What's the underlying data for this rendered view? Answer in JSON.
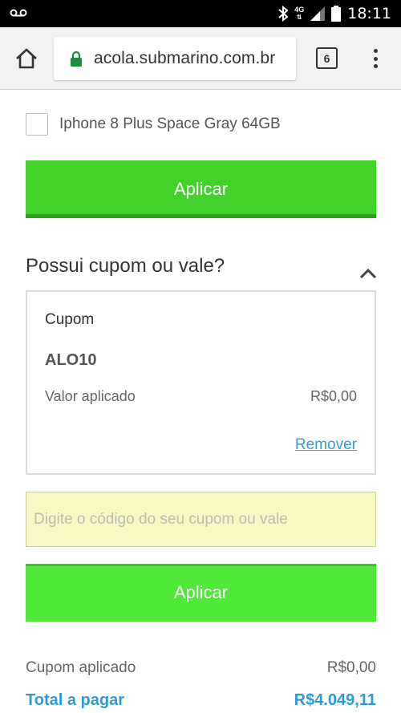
{
  "status_bar": {
    "network": "4G",
    "time": "18:11"
  },
  "browser": {
    "url": "acola.submarino.com.br",
    "tab_count": "6"
  },
  "product": {
    "label": "Iphone 8 Plus Space Gray 64GB",
    "checked": false
  },
  "buttons": {
    "apply_label": "Aplicar"
  },
  "coupon": {
    "section_title": "Possui cupom ou vale?",
    "card_label": "Cupom",
    "code": "ALO10",
    "value_label": "Valor aplicado",
    "value": "R$0,00",
    "remove_label": "Remover",
    "input_placeholder": "Digite o código do seu cupom ou vale",
    "input_value": ""
  },
  "summary": {
    "applied_label": "Cupom aplicado",
    "applied_value": "R$0,00",
    "total_label": "Total a pagar",
    "total_value": "R$4.049,11"
  },
  "colors": {
    "apply_button": "#43d12b",
    "total_text": "#2e9ad6",
    "remove_link": "#3a9bd5",
    "input_background": "#f7f8c3"
  },
  "icons": [
    "voicemail-icon",
    "bluetooth-icon",
    "signal-icon",
    "battery-icon",
    "home-icon",
    "lock-icon",
    "more-vert-icon",
    "chevron-up-icon"
  ]
}
